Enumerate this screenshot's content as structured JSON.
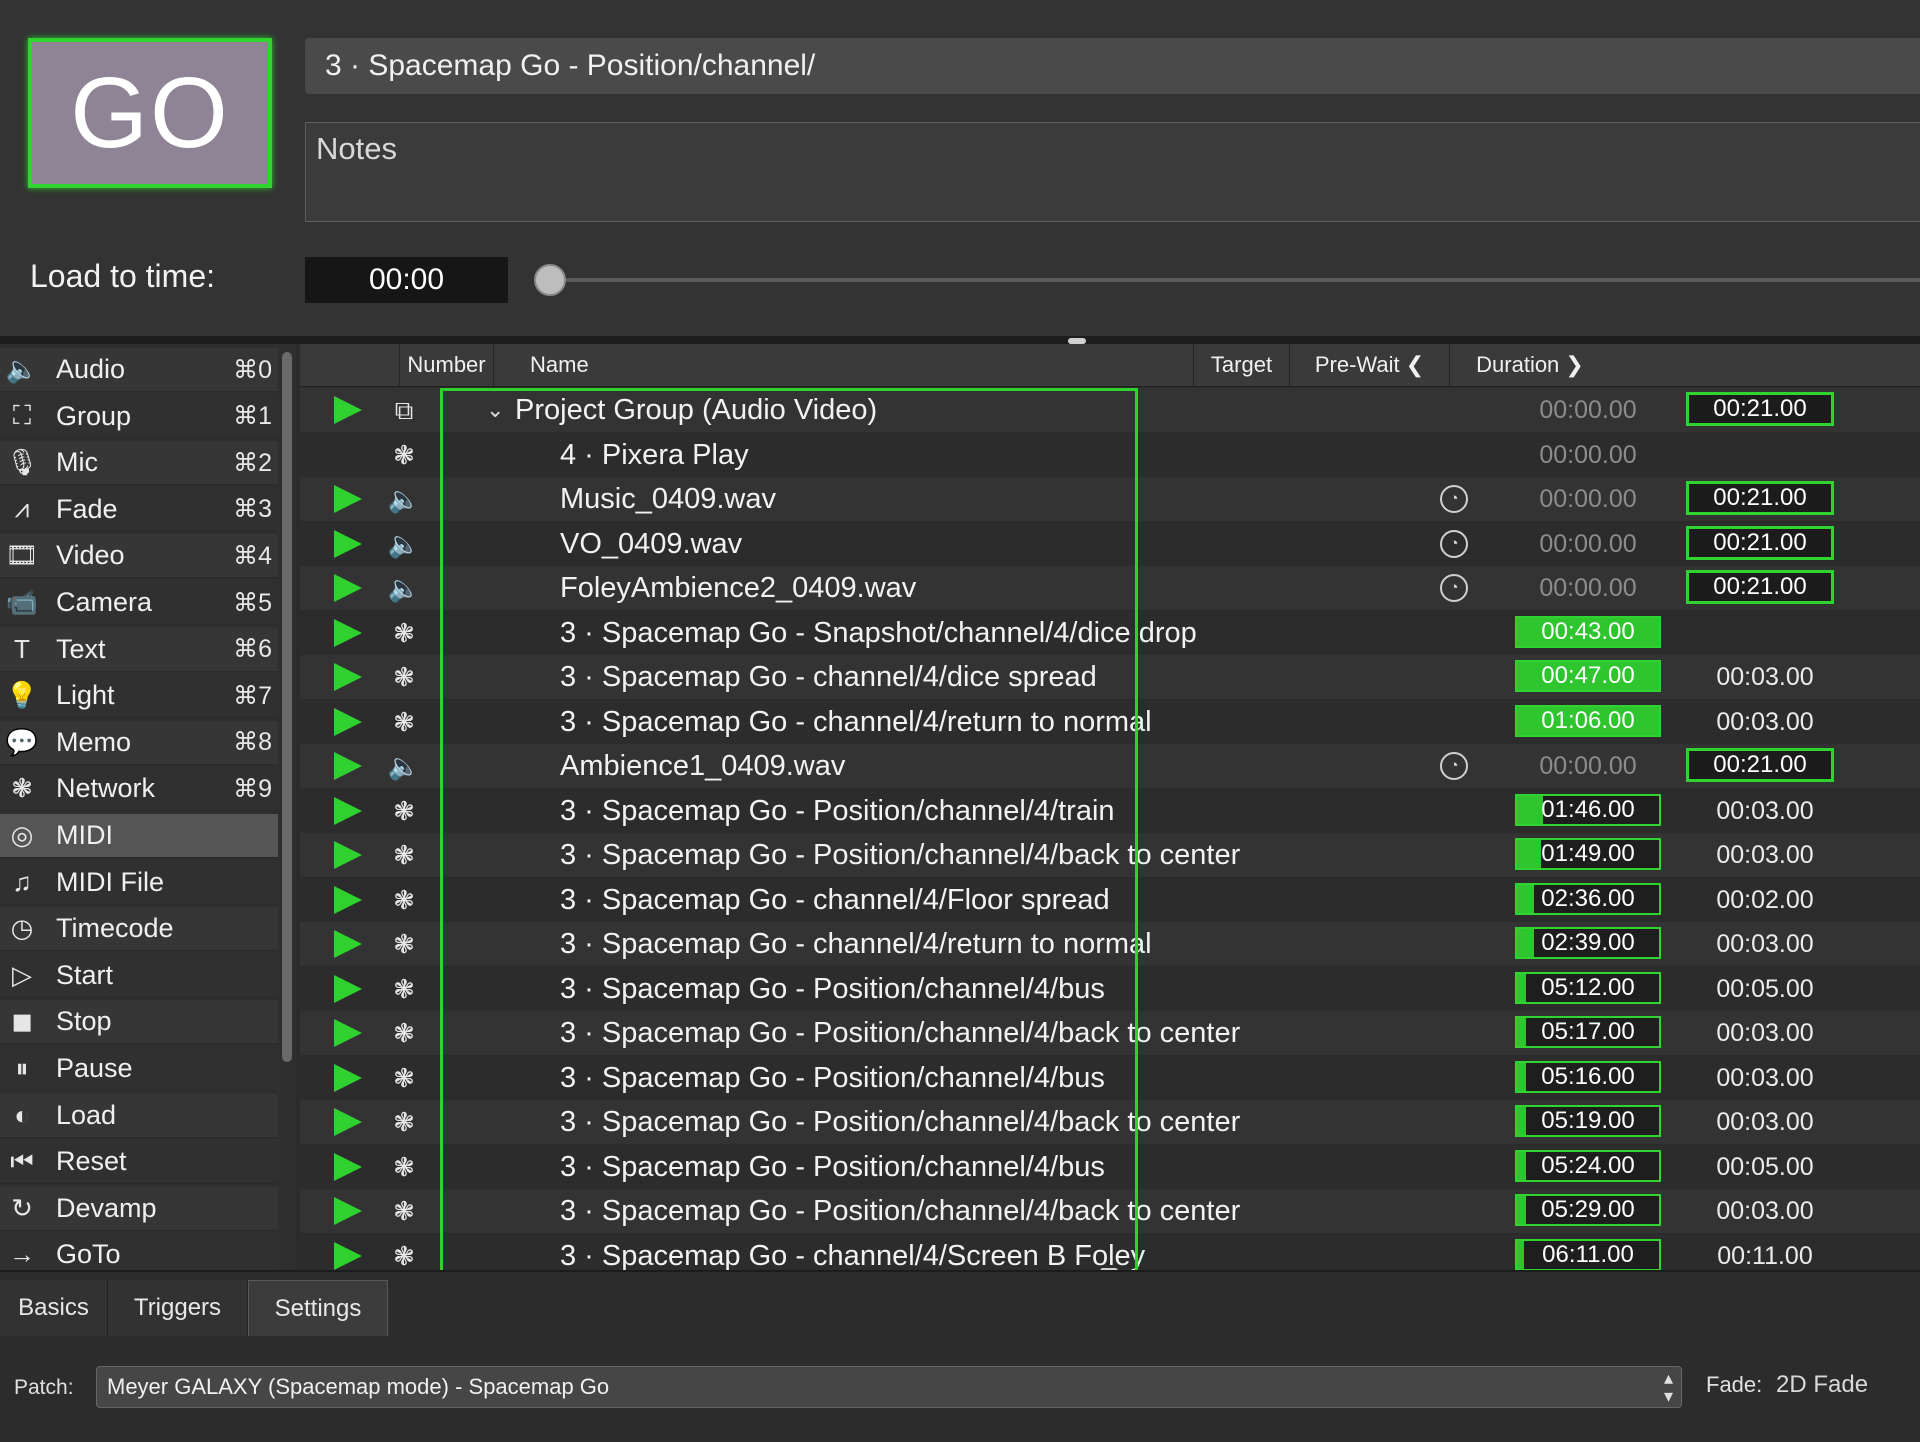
{
  "top": {
    "go_label": "GO",
    "cue_title": "3 · Spacemap Go - Position/channel/",
    "notes_placeholder": "Notes",
    "load_label": "Load to time:",
    "load_time": "00:00"
  },
  "sidebar": {
    "items": [
      {
        "label": "Audio",
        "key": "⌘0",
        "icon": "speaker-icon",
        "glyph": "🔈"
      },
      {
        "label": "Group",
        "key": "⌘1",
        "icon": "group-icon",
        "glyph": "⛶"
      },
      {
        "label": "Mic",
        "key": "⌘2",
        "icon": "mic-icon",
        "glyph": "🎙"
      },
      {
        "label": "Fade",
        "key": "⌘3",
        "icon": "fade-icon",
        "glyph": "⩘"
      },
      {
        "label": "Video",
        "key": "⌘4",
        "icon": "film-icon",
        "glyph": "🎞"
      },
      {
        "label": "Camera",
        "key": "⌘5",
        "icon": "camera-icon",
        "glyph": "📹"
      },
      {
        "label": "Text",
        "key": "⌘6",
        "icon": "text-icon",
        "glyph": "T"
      },
      {
        "label": "Light",
        "key": "⌘7",
        "icon": "bulb-icon",
        "glyph": "💡"
      },
      {
        "label": "Memo",
        "key": "⌘8",
        "icon": "speech-bubble-icon",
        "glyph": "💬"
      },
      {
        "label": "Network",
        "key": "⌘9",
        "icon": "network-icon",
        "glyph": "❃"
      },
      {
        "label": "MIDI",
        "key": "",
        "icon": "midi-icon",
        "glyph": "◎"
      },
      {
        "label": "MIDI File",
        "key": "",
        "icon": "music-note-icon",
        "glyph": "♫"
      },
      {
        "label": "Timecode",
        "key": "",
        "icon": "clock-icon",
        "glyph": "◷"
      },
      {
        "label": "Start",
        "key": "",
        "icon": "play-circle-icon",
        "glyph": "▷"
      },
      {
        "label": "Stop",
        "key": "",
        "icon": "stop-circle-icon",
        "glyph": "◼"
      },
      {
        "label": "Pause",
        "key": "",
        "icon": "pause-circle-icon",
        "glyph": "⏸"
      },
      {
        "label": "Load",
        "key": "",
        "icon": "load-circle-icon",
        "glyph": "◐"
      },
      {
        "label": "Reset",
        "key": "",
        "icon": "reset-circle-icon",
        "glyph": "⏮"
      },
      {
        "label": "Devamp",
        "key": "",
        "icon": "devamp-icon",
        "glyph": "↻"
      },
      {
        "label": "GoTo",
        "key": "",
        "icon": "arrow-right-icon",
        "glyph": "→"
      }
    ]
  },
  "list": {
    "headers": {
      "number": "Number",
      "name": "Name",
      "target": "Target",
      "prewait": "Pre-Wait ❮",
      "duration": "Duration ❯"
    },
    "rows": [
      {
        "play": true,
        "icon": "group-icon",
        "glyph": "⧉",
        "name": "Project Group (Audio Video)",
        "indent": 0,
        "group": true,
        "target": false,
        "prewait": "00:00.00",
        "prewait_active": false,
        "prewait_fill": 0,
        "duration": "00:21.00",
        "duration_boxed": true
      },
      {
        "play": false,
        "icon": "network-icon",
        "glyph": "❃",
        "name": "4 · Pixera Play",
        "indent": 1,
        "group": false,
        "target": false,
        "prewait": "00:00.00",
        "prewait_active": false,
        "prewait_fill": 0,
        "duration": "",
        "duration_boxed": false
      },
      {
        "play": true,
        "icon": "speaker-icon",
        "glyph": "🔈",
        "name": "Music_0409.wav",
        "indent": 1,
        "group": false,
        "target": true,
        "prewait": "00:00.00",
        "prewait_active": false,
        "prewait_fill": 0,
        "duration": "00:21.00",
        "duration_boxed": true
      },
      {
        "play": true,
        "icon": "speaker-icon",
        "glyph": "🔈",
        "name": "VO_0409.wav",
        "indent": 1,
        "group": false,
        "target": true,
        "prewait": "00:00.00",
        "prewait_active": false,
        "prewait_fill": 0,
        "duration": "00:21.00",
        "duration_boxed": true
      },
      {
        "play": true,
        "icon": "speaker-icon",
        "glyph": "🔈",
        "name": "FoleyAmbience2_0409.wav",
        "indent": 1,
        "group": false,
        "target": true,
        "prewait": "00:00.00",
        "prewait_active": false,
        "prewait_fill": 0,
        "duration": "00:21.00",
        "duration_boxed": true
      },
      {
        "play": true,
        "icon": "network-icon",
        "glyph": "❃",
        "name": "3 · Spacemap Go - Snapshot/channel/4/dice drop",
        "indent": 1,
        "group": false,
        "target": false,
        "prewait": "00:43.00",
        "prewait_active": true,
        "prewait_fill": 1.0,
        "duration": "",
        "duration_boxed": false
      },
      {
        "play": true,
        "icon": "network-icon",
        "glyph": "❃",
        "name": "3 · Spacemap Go - channel/4/dice spread",
        "indent": 1,
        "group": false,
        "target": false,
        "prewait": "00:47.00",
        "prewait_active": true,
        "prewait_fill": 1.0,
        "duration": "00:03.00",
        "duration_boxed": false
      },
      {
        "play": true,
        "icon": "network-icon",
        "glyph": "❃",
        "name": "3 · Spacemap Go - channel/4/return to normal",
        "indent": 1,
        "group": false,
        "target": false,
        "prewait": "01:06.00",
        "prewait_active": true,
        "prewait_fill": 1.0,
        "duration": "00:03.00",
        "duration_boxed": false
      },
      {
        "play": true,
        "icon": "speaker-icon",
        "glyph": "🔈",
        "name": "Ambience1_0409.wav",
        "indent": 1,
        "group": false,
        "target": true,
        "prewait": "00:00.00",
        "prewait_active": false,
        "prewait_fill": 0,
        "duration": "00:21.00",
        "duration_boxed": true
      },
      {
        "play": true,
        "icon": "network-icon",
        "glyph": "❃",
        "name": "3 · Spacemap Go - Position/channel/4/train",
        "indent": 1,
        "group": false,
        "target": false,
        "prewait": "01:46.00",
        "prewait_active": true,
        "prewait_fill": 0.18,
        "duration": "00:03.00",
        "duration_boxed": false
      },
      {
        "play": true,
        "icon": "network-icon",
        "glyph": "❃",
        "name": "3 · Spacemap Go - Position/channel/4/back to center",
        "indent": 1,
        "group": false,
        "target": false,
        "prewait": "01:49.00",
        "prewait_active": true,
        "prewait_fill": 0.17,
        "duration": "00:03.00",
        "duration_boxed": false
      },
      {
        "play": true,
        "icon": "network-icon",
        "glyph": "❃",
        "name": "3 · Spacemap Go - channel/4/Floor spread",
        "indent": 1,
        "group": false,
        "target": false,
        "prewait": "02:36.00",
        "prewait_active": true,
        "prewait_fill": 0.12,
        "duration": "00:02.00",
        "duration_boxed": false
      },
      {
        "play": true,
        "icon": "network-icon",
        "glyph": "❃",
        "name": "3 · Spacemap Go - channel/4/return to normal",
        "indent": 1,
        "group": false,
        "target": false,
        "prewait": "02:39.00",
        "prewait_active": true,
        "prewait_fill": 0.12,
        "duration": "00:03.00",
        "duration_boxed": false
      },
      {
        "play": true,
        "icon": "network-icon",
        "glyph": "❃",
        "name": "3 · Spacemap Go - Position/channel/4/bus",
        "indent": 1,
        "group": false,
        "target": false,
        "prewait": "05:12.00",
        "prewait_active": true,
        "prewait_fill": 0.06,
        "duration": "00:05.00",
        "duration_boxed": false
      },
      {
        "play": true,
        "icon": "network-icon",
        "glyph": "❃",
        "name": "3 · Spacemap Go - Position/channel/4/back to center",
        "indent": 1,
        "group": false,
        "target": false,
        "prewait": "05:17.00",
        "prewait_active": true,
        "prewait_fill": 0.06,
        "duration": "00:03.00",
        "duration_boxed": false
      },
      {
        "play": true,
        "icon": "network-icon",
        "glyph": "❃",
        "name": "3 · Spacemap Go - Position/channel/4/bus",
        "indent": 1,
        "group": false,
        "target": false,
        "prewait": "05:16.00",
        "prewait_active": true,
        "prewait_fill": 0.06,
        "duration": "00:03.00",
        "duration_boxed": false
      },
      {
        "play": true,
        "icon": "network-icon",
        "glyph": "❃",
        "name": "3 · Spacemap Go - Position/channel/4/back to center",
        "indent": 1,
        "group": false,
        "target": false,
        "prewait": "05:19.00",
        "prewait_active": true,
        "prewait_fill": 0.06,
        "duration": "00:03.00",
        "duration_boxed": false
      },
      {
        "play": true,
        "icon": "network-icon",
        "glyph": "❃",
        "name": "3 · Spacemap Go - Position/channel/4/bus",
        "indent": 1,
        "group": false,
        "target": false,
        "prewait": "05:24.00",
        "prewait_active": true,
        "prewait_fill": 0.06,
        "duration": "00:05.00",
        "duration_boxed": false
      },
      {
        "play": true,
        "icon": "network-icon",
        "glyph": "❃",
        "name": "3 · Spacemap Go - Position/channel/4/back to center",
        "indent": 1,
        "group": false,
        "target": false,
        "prewait": "05:29.00",
        "prewait_active": true,
        "prewait_fill": 0.06,
        "duration": "00:03.00",
        "duration_boxed": false
      },
      {
        "play": true,
        "icon": "network-icon",
        "glyph": "❃",
        "name": "3 · Spacemap Go - channel/4/Screen B Foley",
        "indent": 1,
        "group": false,
        "target": false,
        "prewait": "06:11.00",
        "prewait_active": true,
        "prewait_fill": 0.05,
        "duration": "00:11.00",
        "duration_boxed": false
      }
    ]
  },
  "bottom": {
    "tabs": [
      "Basics",
      "Triggers",
      "Settings"
    ],
    "active_tab": "Settings",
    "patch_label": "Patch:",
    "patch_value": "Meyer GALAXY (Spacemap mode) - Spacemap Go",
    "fade_label": "Fade:",
    "fade_value": "2D Fade"
  },
  "colors": {
    "accent_green": "#30d430",
    "go_button": "#8f8495",
    "background": "#2b2b2b"
  }
}
